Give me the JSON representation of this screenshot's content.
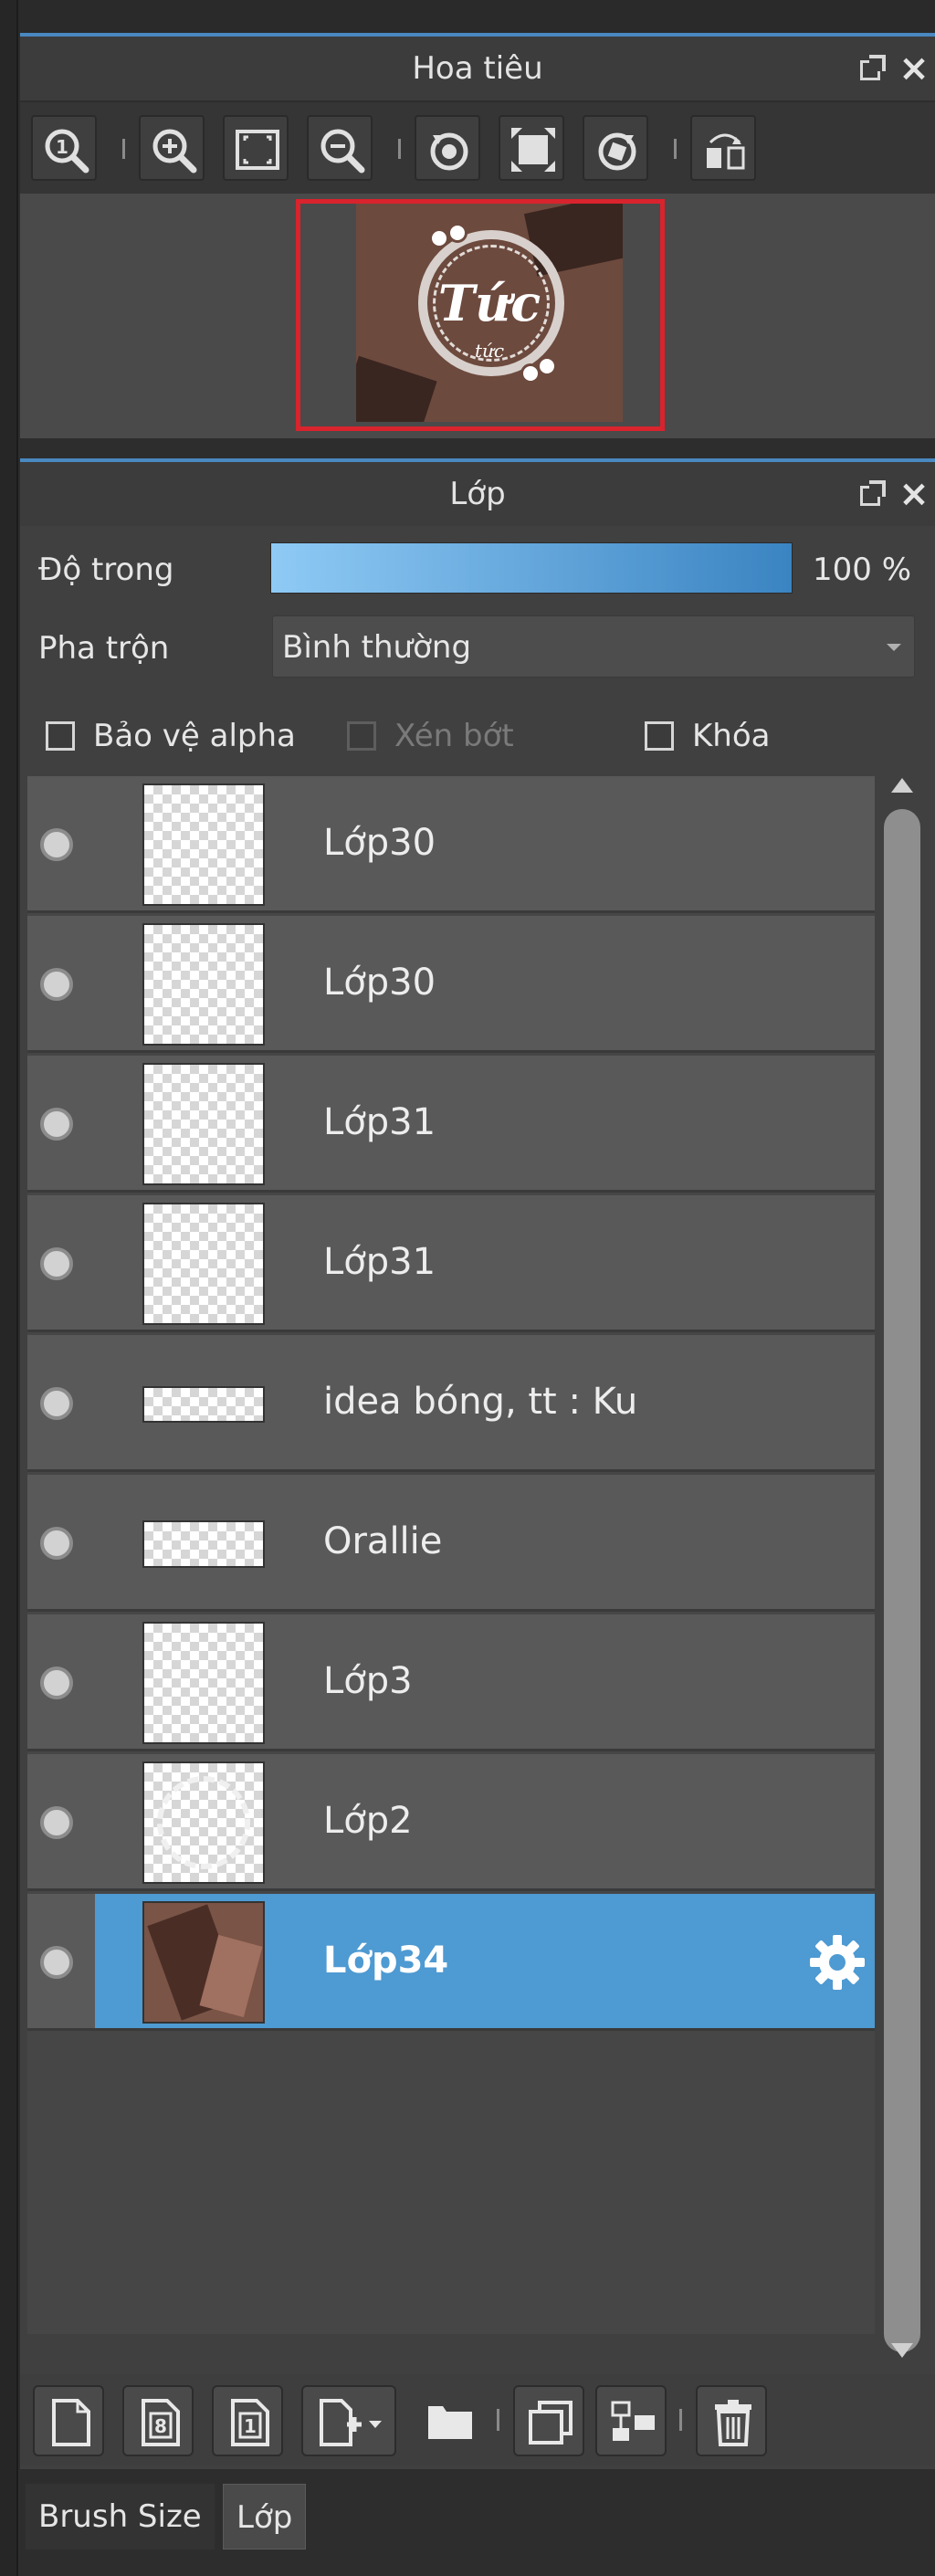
{
  "navigator": {
    "title": "Hoa tiêu",
    "thumbnail_logo": "Tức",
    "thumbnail_sub": "tức"
  },
  "layers_panel": {
    "title": "Lớp",
    "opacity_label": "Độ trong",
    "opacity_value": "100 %",
    "opacity_fraction": 1.0,
    "blend_label": "Pha trộn",
    "blend_value": "Bình thường",
    "checkbox_alpha": "Bảo vệ alpha",
    "checkbox_clip": "Xén bớt",
    "checkbox_lock": "Khóa",
    "layers": [
      {
        "name": "Lớp30"
      },
      {
        "name": "Lớp30"
      },
      {
        "name": "Lớp31"
      },
      {
        "name": "Lớp31"
      },
      {
        "name": "idea bóng, tt : Ku"
      },
      {
        "name": "Orallie"
      },
      {
        "name": "Lớp3"
      },
      {
        "name": "Lớp2"
      },
      {
        "name": "Lớp34"
      }
    ],
    "selected_layer_color": "#4e9ad2"
  },
  "tabs": {
    "brush_size": "Brush Size",
    "layer": "Lớp"
  },
  "icons": {
    "nav_toolbar": [
      "zoom-actual-icon",
      "zoom-in-icon",
      "fit-icon",
      "zoom-out-icon",
      "rotate-left-icon",
      "fullscreen-icon",
      "rotate-right-icon",
      "flip-icon"
    ],
    "bottom_toolbar": [
      "new-layer-icon",
      "new-8bit-layer-icon",
      "new-1bit-layer-icon",
      "add-layer-menu-icon",
      "folder-icon",
      "duplicate-icon",
      "merge-down-icon",
      "delete-icon"
    ]
  }
}
